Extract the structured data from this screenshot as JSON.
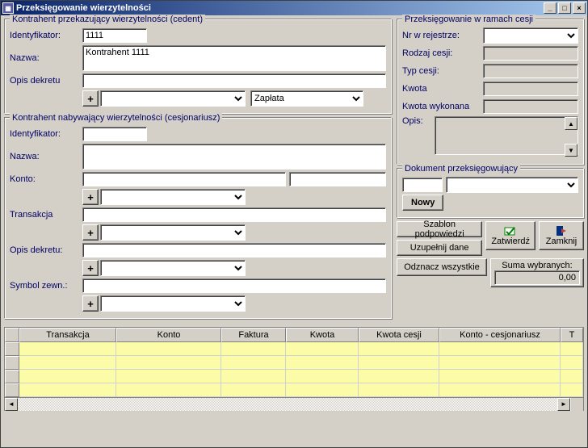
{
  "window": {
    "title": "Przeksięgowanie wierzytelności"
  },
  "cedent": {
    "legend": "Kontrahent przekazujący wierzytelności (cedent)",
    "id_label": "Identyfikator:",
    "id_value": "1111",
    "name_label": "Nazwa:",
    "name_value": "Kontrahent 1111",
    "dekret_label": "Opis dekretu",
    "plus": "+",
    "zaplata": "Zapłata"
  },
  "cesjonariusz": {
    "legend": "Kontrahent nabywający wierzytelności (cesjonariusz)",
    "id_label": "Identyfikator:",
    "name_label": "Nazwa:",
    "konto_label": "Konto:",
    "trans_label": "Transakcja",
    "dekret_label": "Opis dekretu:",
    "symbol_label": "Symbol zewn.:",
    "plus": "+"
  },
  "cesja": {
    "legend": "Przeksięgowanie w ramach cesji",
    "nr_label": "Nr w rejestrze:",
    "rodzaj_label": "Rodzaj cesji:",
    "typ_label": "Typ cesji:",
    "kwota_label": "Kwota",
    "kwota_wyk_label": "Kwota wykonana",
    "opis_label": "Opis:"
  },
  "dokument": {
    "legend": "Dokument przeksięgowujący",
    "nowy": "Nowy"
  },
  "buttons": {
    "szablon": "Szablon podpowiedzi",
    "uzupelnij": "Uzupełnij dane",
    "odznacz": "Odznacz wszystkie",
    "zatwierdz": "Zatwierdź",
    "zamknij": "Zamknij"
  },
  "sum": {
    "label": "Suma wybranych:",
    "value": "0,00"
  },
  "grid": {
    "cols": [
      "Transakcja",
      "Konto",
      "Faktura",
      "Kwota",
      "Kwota cesji",
      "Konto - cesjonariusz",
      "T"
    ]
  }
}
